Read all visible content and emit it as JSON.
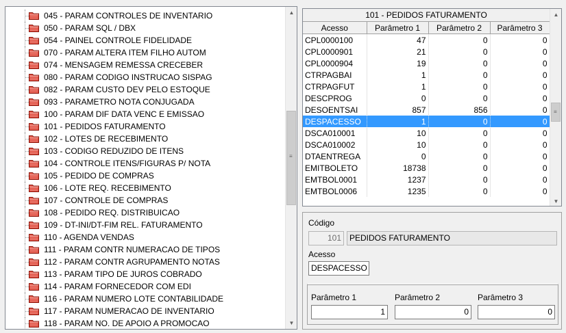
{
  "tree": {
    "items": [
      "045 - PARAM CONTROLES DE INVENTARIO",
      "050 - PARAM SQL / DBX",
      "054 - PAINEL CONTROLE FIDELIDADE",
      "070 - PARAM ALTERA ITEM FILHO AUTOM",
      "074 - MENSAGEM REMESSA CRECEBER",
      "080 - PARAM CODIGO INSTRUCAO SISPAG",
      "082 - PARAM CUSTO DEV PELO ESTOQUE",
      "093 - PARAMETRO NOTA CONJUGADA",
      "100 - PARAM DIF DATA VENC E EMISSAO",
      "101 - PEDIDOS FATURAMENTO",
      "102 - LOTES DE RECEBIMENTO",
      "103 - CODIGO REDUZIDO DE ITENS",
      "104 - CONTROLE ITENS/FIGURAS P/ NOTA",
      "105 - PEDIDO DE COMPRAS",
      "106 - LOTE REQ. RECEBIMENTO",
      "107 - CONTROLE DE COMPRAS",
      "108 - PEDIDO REQ. DISTRIBUICAO",
      "109 - DT-INI/DT-FIM REL. FATURAMENTO",
      "110 - AGENDA VENDAS",
      "111 - PARAM CONTR NUMERACAO DE TIPOS",
      "112 - PARAM CONTR AGRUPAMENTO NOTAS",
      "113 - PARAM TIPO DE JUROS COBRADO",
      "114 - PARAM FORNECEDOR COM EDI",
      "116 - PARAM NUMERO LOTE CONTABILIDADE",
      "117 - PARAM NUMERACAO DE INVENTARIO",
      "118 - PARAM NO. DE APOIO A PROMOCAO"
    ]
  },
  "grid": {
    "caption": "101 - PEDIDOS FATURAMENTO",
    "headers": [
      "Acesso",
      "Parâmetro 1",
      "Parâmetro 2",
      "Parâmetro 3"
    ],
    "selected_index": 7,
    "rows": [
      [
        "CPL0000100",
        "47",
        "0",
        "0"
      ],
      [
        "CPL0000901",
        "21",
        "0",
        "0"
      ],
      [
        "CPL0000904",
        "19",
        "0",
        "0"
      ],
      [
        "CTRPAGBAI",
        "1",
        "0",
        "0"
      ],
      [
        "CTRPAGFUT",
        "1",
        "0",
        "0"
      ],
      [
        "DESCPROG",
        "0",
        "0",
        "0"
      ],
      [
        "DESOENTSAI",
        "857",
        "856",
        "0"
      ],
      [
        "DESPACESSO",
        "1",
        "0",
        "0"
      ],
      [
        "DSCA010001",
        "10",
        "0",
        "0"
      ],
      [
        "DSCA010002",
        "10",
        "0",
        "0"
      ],
      [
        "DTAENTREGA",
        "0",
        "0",
        "0"
      ],
      [
        "EMITBOLETO",
        "18738",
        "0",
        "0"
      ],
      [
        "EMTBOL0001",
        "1237",
        "0",
        "0"
      ],
      [
        "EMTBOL0006",
        "1235",
        "0",
        "0"
      ]
    ]
  },
  "detail": {
    "codigo_label": "Código",
    "codigo_value": "101",
    "nome_value": "PEDIDOS FATURAMENTO",
    "acesso_label": "Acesso",
    "acesso_value": "DESPACESSO",
    "p1_label": "Parâmetro 1",
    "p1_value": "1",
    "p2_label": "Parâmetro 2",
    "p2_value": "0",
    "p3_label": "Parâmetro 3",
    "p3_value": "0"
  },
  "icons": {
    "folder": "folder-icon",
    "scroll_up": "scroll-up-arrow-icon",
    "scroll_down": "scroll-down-arrow-icon",
    "grip": "scroll-grip-icon"
  },
  "colors": {
    "selection": "#3399ff",
    "folder_red": "#c0392b"
  }
}
